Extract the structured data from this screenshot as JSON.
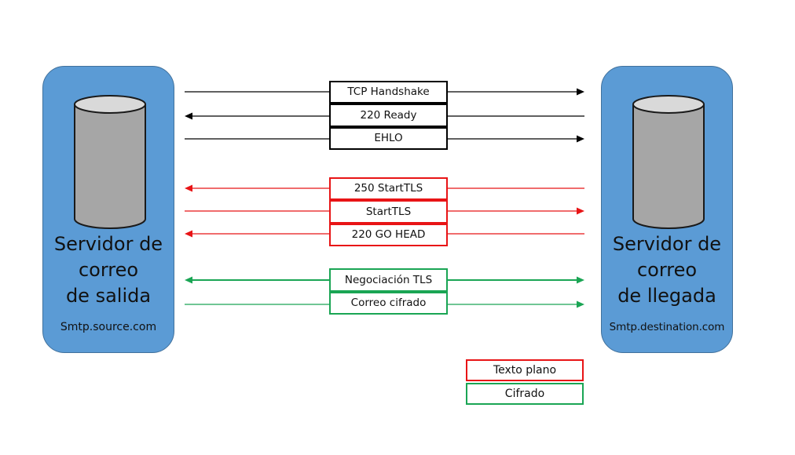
{
  "colors": {
    "server_fill": "#5b9bd5",
    "server_border": "#41719c",
    "cylinder_body": "#a6a6a6",
    "cylinder_top": "#d9d9d9",
    "plain_handshake": "#000000",
    "plain_text": "#e81416",
    "encrypted": "#1aa554"
  },
  "servers": {
    "source": {
      "name": "Servidor de\ncorreo\nde salida",
      "host": "Smtp.source.com",
      "icon": "database-cylinder-icon"
    },
    "destination": {
      "name": "Servidor de\ncorreo\nde llegada",
      "host": "Smtp.destination.com",
      "icon": "database-cylinder-icon"
    }
  },
  "messages": [
    {
      "label": "TCP Handshake",
      "direction": "to-destination",
      "group": "handshake"
    },
    {
      "label": "220 Ready",
      "direction": "to-source",
      "group": "handshake"
    },
    {
      "label": "EHLO",
      "direction": "to-destination",
      "group": "handshake"
    },
    {
      "label": "250 StartTLS",
      "direction": "to-source",
      "group": "plain"
    },
    {
      "label": "StartTLS",
      "direction": "to-destination",
      "group": "plain"
    },
    {
      "label": "220 GO HEAD",
      "direction": "to-source",
      "group": "plain"
    },
    {
      "label": "Negociación TLS",
      "direction": "both",
      "group": "encrypted"
    },
    {
      "label": "Correo cifrado",
      "direction": "to-destination",
      "group": "encrypted"
    }
  ],
  "legend": [
    {
      "label": "Texto plano",
      "group": "plain"
    },
    {
      "label": "Cifrado",
      "group": "encrypted"
    }
  ]
}
